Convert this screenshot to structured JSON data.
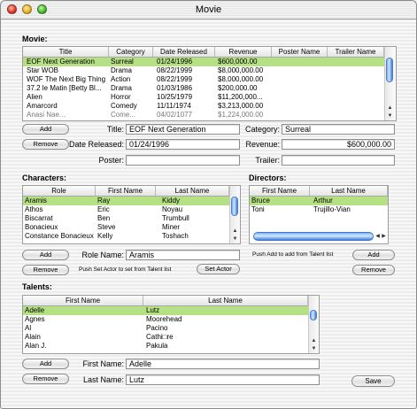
{
  "window": {
    "title": "Movie"
  },
  "movie": {
    "section_label": "Movie:",
    "columns": [
      "Title",
      "Category",
      "Date Released",
      "Revenue",
      "Poster Name",
      "Trailer Name"
    ],
    "rows": [
      [
        "EOF Next Generation",
        "Surreal",
        "01/24/1996",
        "$600,000.00",
        "",
        ""
      ],
      [
        "Star WOB",
        "Drama",
        "08/22/1999",
        "$8,000,000.00",
        "",
        ""
      ],
      [
        "WOF The Next Big Thing",
        "Action",
        "08/22/1999",
        "$8,000,000.00",
        "",
        ""
      ],
      [
        "37.2 le Matin [Betty Bl...",
        "Drama",
        "01/03/1986",
        "$200,000.00",
        "",
        ""
      ],
      [
        "Alien",
        "Horror",
        "10/25/1979",
        "$11,200,000...",
        "",
        ""
      ],
      [
        "Amarcord",
        "Comedy",
        "11/11/1974",
        "$3,213,000.00",
        "",
        ""
      ],
      [
        "Anasi Nae...",
        "Come...",
        "04/02/1077",
        "$1,224,000.00",
        "",
        ""
      ]
    ],
    "add_label": "Add",
    "remove_label": "Remove",
    "title_label": "Title:",
    "title_value": "EOF Next Generation",
    "category_label": "Category:",
    "category_value": "Surreal",
    "date_label": "Date Released:",
    "date_value": "01/24/1996",
    "revenue_label": "Revenue:",
    "revenue_value": "$600,000.00",
    "poster_label": "Poster:",
    "poster_value": "",
    "trailer_label": "Trailer:",
    "trailer_value": ""
  },
  "characters": {
    "section_label": "Characters:",
    "columns": [
      "Role",
      "First Name",
      "Last Name"
    ],
    "rows": [
      [
        "Aramis",
        "Ray",
        "Kiddy"
      ],
      [
        "Athos",
        "Eric",
        "Noyau"
      ],
      [
        "Biscarrat",
        "Ben",
        "Trumbull"
      ],
      [
        "Bonacieux",
        "Steve",
        "Miner"
      ],
      [
        "Constance Bonacieux",
        "Kelly",
        "Toshach"
      ]
    ],
    "add_label": "Add",
    "remove_label": "Remove",
    "role_label": "Role Name:",
    "role_value": "Aramis",
    "note": "Push Set Actor to set from Talent list",
    "set_actor_label": "Set Actor"
  },
  "directors": {
    "section_label": "Directors:",
    "columns": [
      "First Name",
      "Last Name"
    ],
    "rows": [
      [
        "Bruce",
        "Arthur"
      ],
      [
        "Toni",
        "Trujillo-Vian"
      ]
    ],
    "note": "Push Add to add from Talent list",
    "add_label": "Add",
    "remove_label": "Remove"
  },
  "talents": {
    "section_label": "Talents:",
    "columns": [
      "First Name",
      "Last Name"
    ],
    "rows": [
      [
        "Adelle",
        "Lutz"
      ],
      [
        "Agnes",
        "Moorehead"
      ],
      [
        "Al",
        "Pacino"
      ],
      [
        "Alain",
        "Cathi□re"
      ],
      [
        "Alan J.",
        "Pakula"
      ]
    ],
    "add_label": "Add",
    "remove_label": "Remove",
    "first_label": "First Name:",
    "first_value": "Adelle",
    "last_label": "Last Name:",
    "last_value": "Lutz",
    "save_label": "Save"
  },
  "colors": {
    "selection": "#b5e083",
    "accent": "#3c7ad6"
  }
}
